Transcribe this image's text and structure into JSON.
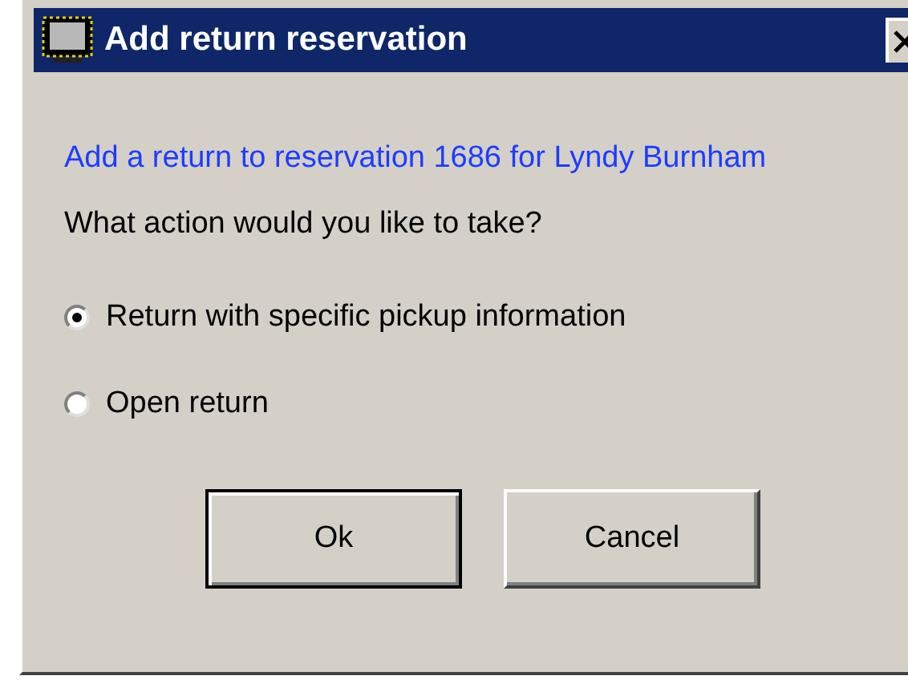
{
  "window": {
    "title": "Add return reservation"
  },
  "message": "Add a return to reservation 1686 for Lyndy Burnham",
  "question": "What action would you like to take?",
  "options": [
    {
      "label": "Return with specific pickup information",
      "selected": true
    },
    {
      "label": "Open return",
      "selected": false
    }
  ],
  "buttons": [
    {
      "label": "Ok",
      "default": true
    },
    {
      "label": "Cancel",
      "default": false
    }
  ]
}
